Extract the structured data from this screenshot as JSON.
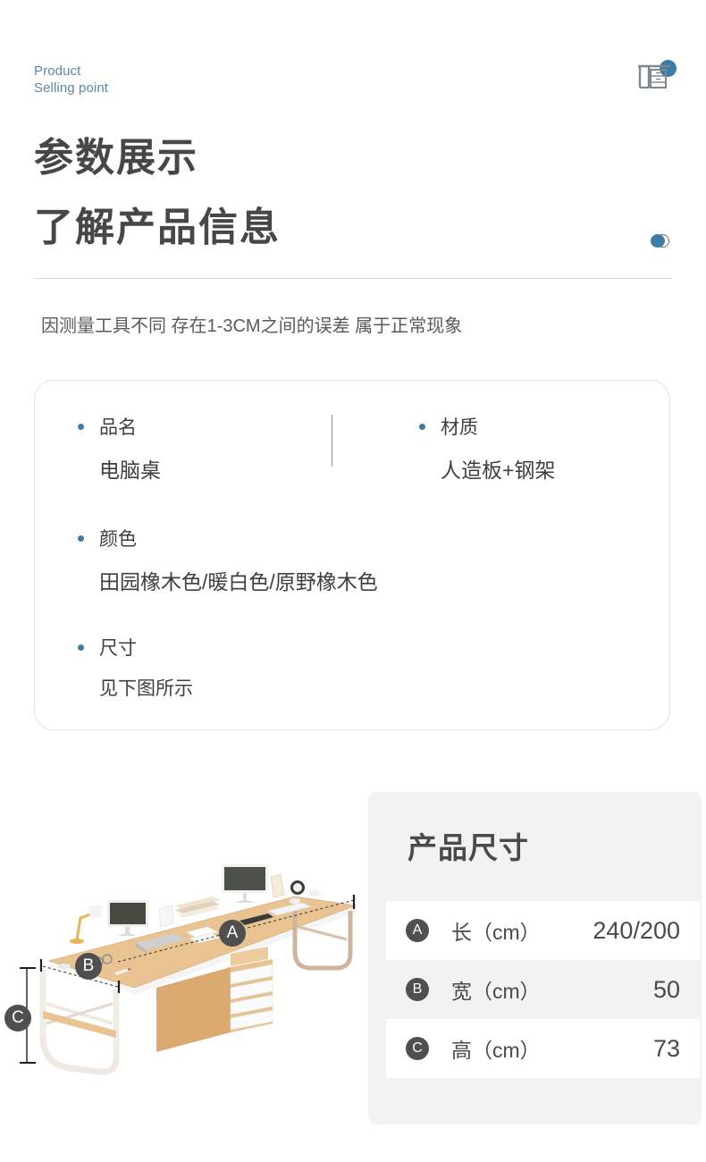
{
  "header": {
    "eyebrow": "Product\nSelling point",
    "desk_icon": "desk-icon",
    "dot_color": "#3e7ca8"
  },
  "headings": {
    "line1": "参数展示",
    "line2": "了解产品信息"
  },
  "note": "因测量工具不同 存在1-3CM之间的误差 属于正常现象",
  "spec_card": {
    "items": [
      {
        "key": "品名",
        "value": "电脑桌"
      },
      {
        "key": "材质",
        "value": "人造板+钢架"
      },
      {
        "key": "颜色",
        "value": "田园橡木色/暖白色/原野橡木色"
      },
      {
        "key": "尺寸",
        "value": "见下图所示"
      }
    ]
  },
  "photo": {
    "labels": [
      {
        "id": "A",
        "meaning": "length"
      },
      {
        "id": "B",
        "meaning": "width"
      },
      {
        "id": "C",
        "meaning": "height"
      }
    ]
  },
  "dimensions": {
    "title": "产品尺寸",
    "rows": [
      {
        "badge": "A",
        "label": "长（cm）",
        "value": "240/200"
      },
      {
        "badge": "B",
        "label": "宽（cm）",
        "value": "50"
      },
      {
        "badge": "C",
        "label": "高（cm）",
        "value": "73"
      }
    ]
  },
  "colors": {
    "accent_blue": "#3e7ca8",
    "eyebrow_blue": "#5b87ad",
    "heading_gray": "#474747",
    "panel_gray": "#f2f2f2",
    "badge_gray": "#4f4f4f"
  }
}
